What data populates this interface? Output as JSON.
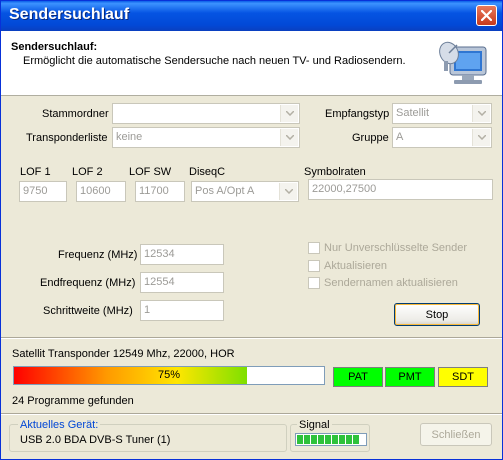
{
  "window": {
    "title": "Sendersuchlauf"
  },
  "header": {
    "title": "Sendersuchlauf:",
    "description": "Ermöglicht die automatische Sendersuche nach neuen TV- und Radiosendern."
  },
  "form": {
    "stammordner_label": "Stammordner",
    "stammordner_value": "",
    "transponderliste_label": "Transponderliste",
    "transponderliste_value": "keine",
    "empfangstyp_label": "Empfangstyp",
    "empfangstyp_value": "Satellit",
    "gruppe_label": "Gruppe",
    "gruppe_value": "A",
    "lof1_label": "LOF 1",
    "lof1_value": "9750",
    "lof2_label": "LOF 2",
    "lof2_value": "10600",
    "lofsw_label": "LOF SW",
    "lofsw_value": "11700",
    "diseqc_label": "DiseqC",
    "diseqc_value": "Pos A/Opt A",
    "symbolraten_label": "Symbolraten",
    "symbolraten_value": "22000,27500",
    "frequenz_label": "Frequenz (MHz)",
    "frequenz_value": "12534",
    "endfrequenz_label": "Endfrequenz (MHz)",
    "endfrequenz_value": "12554",
    "schrittweite_label": "Schrittweite (MHz)",
    "schrittweite_value": "1"
  },
  "options": {
    "nur_unverschluesselt": "Nur Unverschlüsselte Sender",
    "aktualisieren": "Aktualisieren",
    "sendernamen": "Sendernamen aktualisieren"
  },
  "buttons": {
    "stop": "Stop",
    "schliessen": "Schließen"
  },
  "scan": {
    "status": "Satellit Transponder 12549 Mhz, 22000, HOR",
    "progress_percent": 75,
    "progress_label": "75%",
    "tags": [
      {
        "label": "PAT",
        "color": "#00ff00"
      },
      {
        "label": "PMT",
        "color": "#00ff00"
      },
      {
        "label": "SDT",
        "color": "#ffff00"
      }
    ],
    "found": "24 Programme gefunden"
  },
  "device": {
    "label": "Aktuelles Gerät:",
    "value": "USB 2.0 BDA DVB-S Tuner (1)"
  },
  "signal": {
    "label": "Signal",
    "level": 0.85
  },
  "colors": {
    "title_blue": "#0554e3",
    "accent_link": "#0046d5",
    "dialog_bg": "#ece9d8"
  }
}
